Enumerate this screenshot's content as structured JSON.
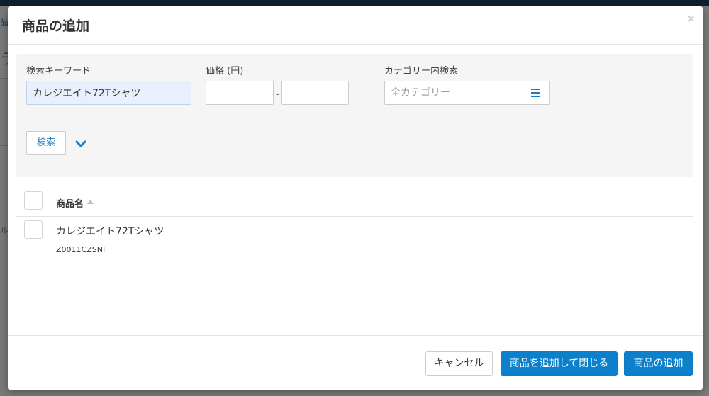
{
  "background": {
    "fragment_top": "品",
    "fragment_mid": "ラ",
    "fragment_low": "ル"
  },
  "modal": {
    "title": "商品の追加",
    "close_symbol": "×"
  },
  "search": {
    "keyword_label": "検索キーワード",
    "keyword_value": "カレジエイト72Tシャツ",
    "price_label": "価格 (円)",
    "price_min": "",
    "price_max": "",
    "price_separator": "-",
    "category_label": "カテゴリー内検索",
    "category_placeholder": "全カテゴリー",
    "category_menu_icon": "list-icon",
    "search_button": "検索",
    "expand_icon": "chevron-down-icon"
  },
  "table": {
    "columns": [
      {
        "label": "商品名",
        "sort": "ascending"
      }
    ],
    "rows": [
      {
        "name": "カレジエイト72Tシャツ",
        "code": "Z0011CZSNI"
      }
    ]
  },
  "footer": {
    "cancel": "キャンセル",
    "add_and_close": "商品を追加して閉じる",
    "add": "商品の追加"
  },
  "colors": {
    "accent": "#0d80cc",
    "header_bar": "#1e3f5a"
  }
}
